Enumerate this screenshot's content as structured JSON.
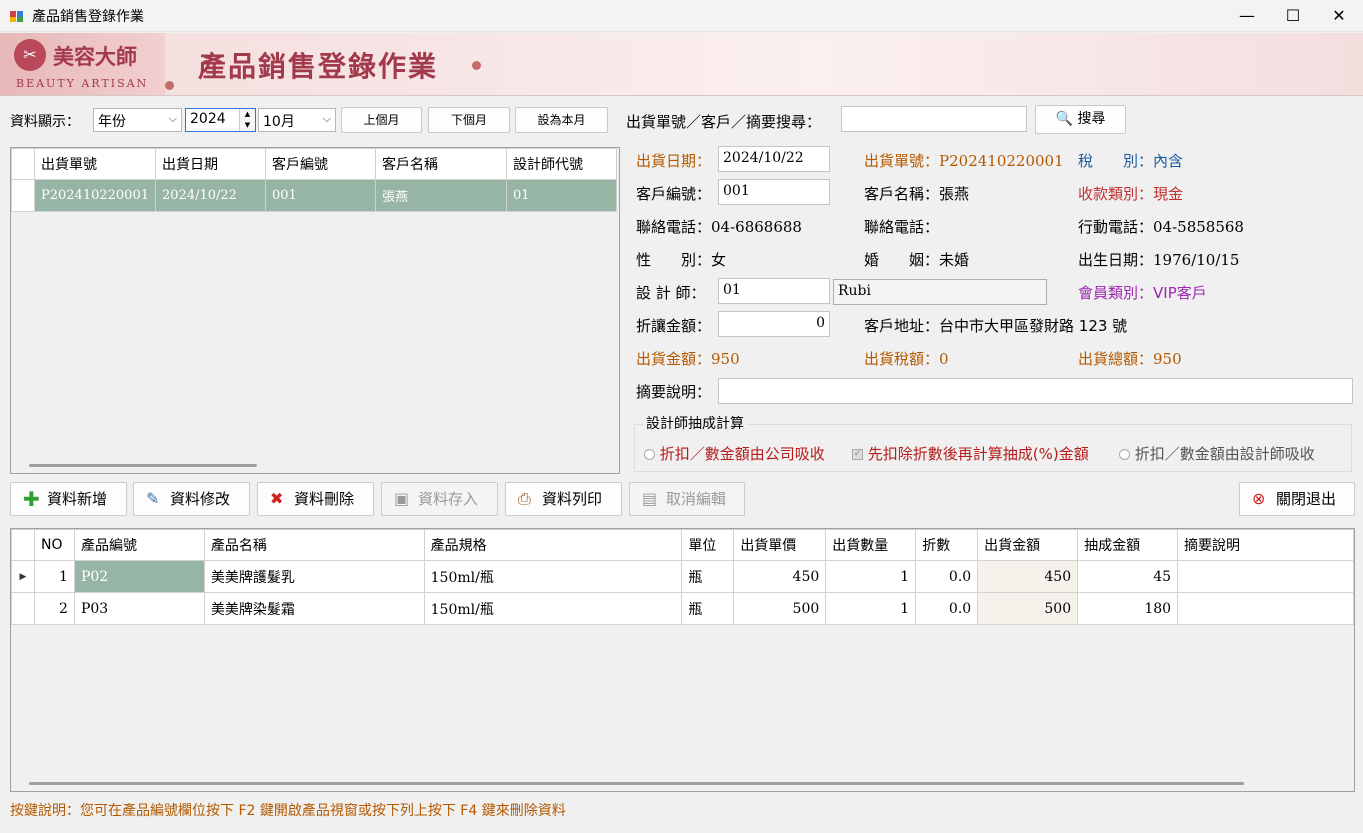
{
  "window": {
    "title": "產品銷售登錄作業",
    "minimize": "—",
    "maximize": "☐",
    "close": "✕"
  },
  "banner": {
    "logo_text": "美容大師",
    "logo_sub": "BEAUTY ARTISAN",
    "title": "產品銷售登錄作業"
  },
  "toolbar": {
    "display_label": "資料顯示：",
    "period_type": "年份",
    "year": "2024",
    "month": "10月",
    "prev_month": "上個月",
    "next_month": "下個月",
    "set_current_month": "設為本月",
    "search_label": "出貨單號／客戶／摘要搜尋：",
    "search_value": "",
    "search_button": "搜尋"
  },
  "order_list": {
    "columns": [
      "出貨單號",
      "出貨日期",
      "客戶編號",
      "客戶名稱",
      "設計師代號"
    ],
    "rows": [
      [
        "P202410220001",
        "2024/10/22",
        "001",
        "張燕",
        "01"
      ]
    ]
  },
  "detail": {
    "ship_date_label": "出貨日期：",
    "ship_date": "2024/10/22",
    "ship_no_label": "出貨單號：",
    "ship_no": "P202410220001",
    "tax_label": "稅　　別：",
    "tax": "內含",
    "cust_no_label": "客戶編號：",
    "cust_no": "001",
    "cust_name_label": "客戶名稱：",
    "cust_name": "張燕",
    "pay_type_label": "收款類別：",
    "pay_type": "現金",
    "phone1_label": "聯絡電話：",
    "phone1": "04-6868688",
    "phone2_label": "聯絡電話：",
    "phone2": "",
    "mobile_label": "行動電話：",
    "mobile": "04-5858568",
    "gender_label": "性　　別：",
    "gender": "女",
    "marriage_label": "婚　　姻：",
    "marriage": "未婚",
    "birth_label": "出生日期：",
    "birth": "1976/10/15",
    "designer_label": "設 計 師：",
    "designer_code": "01",
    "designer_name": "Rubi",
    "member_label": "會員類別：",
    "member": "VIP客戶",
    "discount_label": "折讓金額：",
    "discount": "0",
    "address_label": "客戶地址：",
    "address": "台中市大甲區發財路 123 號",
    "amount_label": "出貨金額：",
    "amount": "950",
    "tax_amount_label": "出貨稅額：",
    "tax_amount": "0",
    "total_label": "出貨總額：",
    "total": "950",
    "memo_label": "摘要說明：",
    "memo": ""
  },
  "commission": {
    "title": "設計師抽成計算",
    "opt1": "折扣／數金額由公司吸收",
    "opt2": "先扣除折數後再計算抽成(%)金額",
    "opt3": "折扣／數金額由設計師吸收"
  },
  "actions": {
    "add": "資料新增",
    "edit": "資料修改",
    "delete": "資料刪除",
    "save": "資料存入",
    "print": "資料列印",
    "cancel": "取消編輯",
    "exit": "關閉退出"
  },
  "items": {
    "columns": [
      "NO",
      "產品編號",
      "產品名稱",
      "產品規格",
      "單位",
      "出貨單價",
      "出貨數量",
      "折數",
      "出貨金額",
      "抽成金額",
      "摘要說明"
    ],
    "rows": [
      [
        "1",
        "P02",
        "美美牌護髮乳",
        "150ml/瓶",
        "瓶",
        "450",
        "1",
        "0.0",
        "450",
        "45",
        ""
      ],
      [
        "2",
        "P03",
        "美美牌染髮霜",
        "150ml/瓶",
        "瓶",
        "500",
        "1",
        "0.0",
        "500",
        "180",
        ""
      ]
    ]
  },
  "footer": {
    "hint": "按鍵說明：您可在產品編號欄位按下 F2 鍵開啟產品視窗或按下列上按下 F4 鍵來刪除資料"
  },
  "colors": {
    "selected_row": "#97b5a5",
    "label_orange": "#b35900",
    "banner_red": "#a33a4c"
  }
}
